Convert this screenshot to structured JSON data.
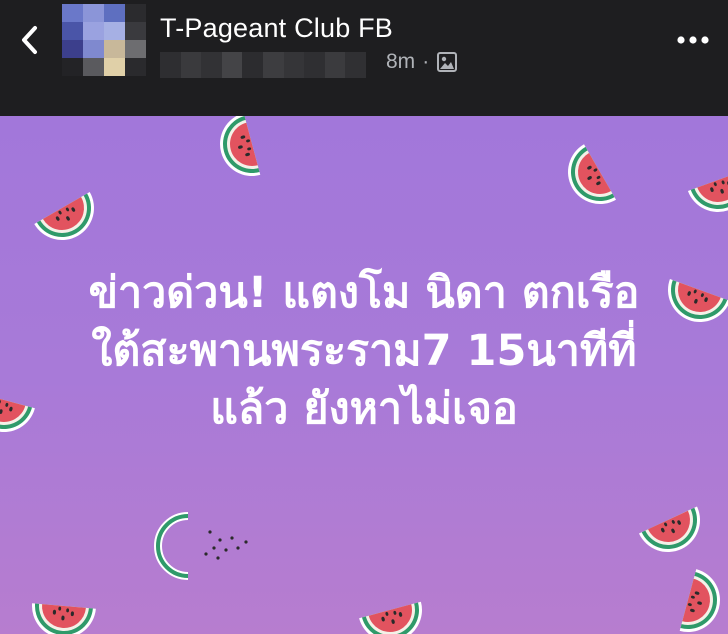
{
  "header": {
    "page_name": "T-Pageant Club FB",
    "time": "8m",
    "separator": "·",
    "back_icon": "chevron-left-icon",
    "audience_icon": "public-photo-icon",
    "more_icon": "more-dots-icon"
  },
  "post": {
    "lines": [
      "ข่าวด่วน! แตงโม นิดา ตกเรือ",
      "ใต้สะพานพระราม7 15นาทีที่",
      "แล้ว ยังหาไม่เจอ"
    ],
    "background_colors": [
      "#a277da",
      "#b77dcf"
    ],
    "decoration": "watermelon-slice-icon"
  }
}
